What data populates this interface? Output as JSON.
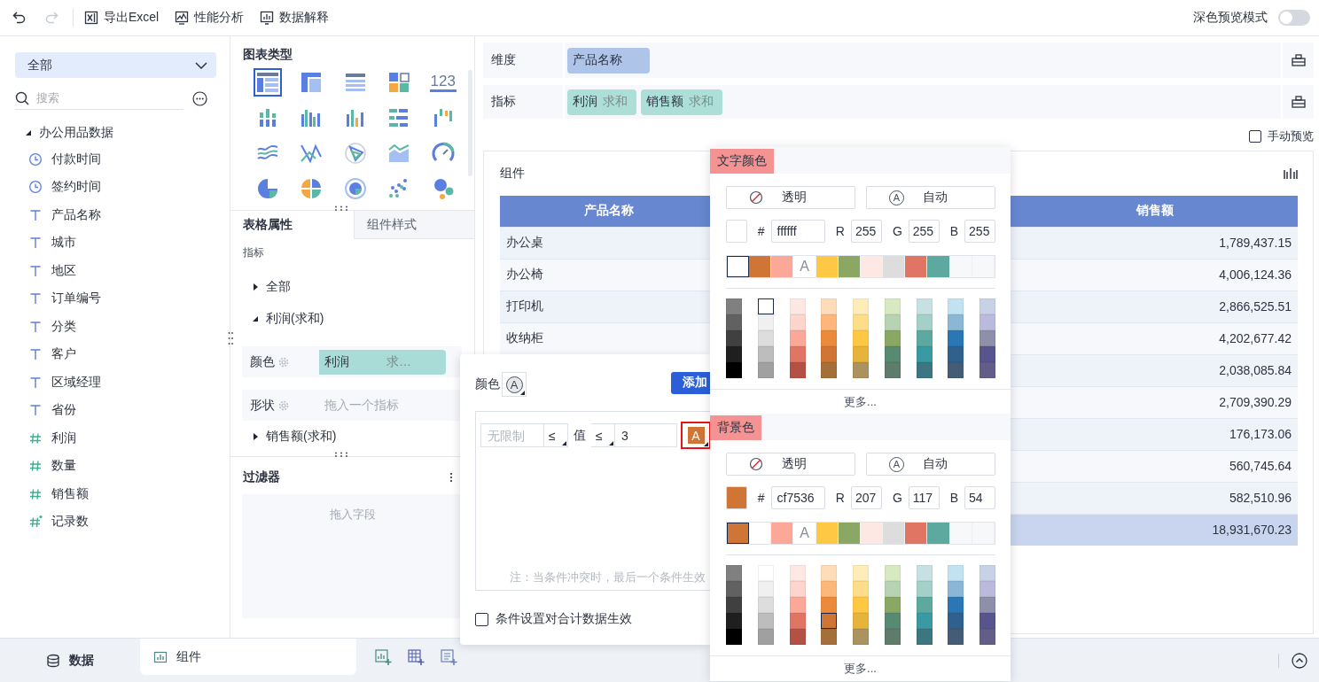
{
  "toolbar": {
    "undo_disabled": false,
    "redo_disabled": true,
    "actions": [
      {
        "kind": "excel",
        "label": "导出Excel"
      },
      {
        "kind": "performance",
        "label": "性能分析"
      },
      {
        "kind": "explain",
        "label": "数据解释"
      }
    ],
    "dark_preview": {
      "label": "深色预览模式",
      "on": false
    }
  },
  "fields_panel": {
    "dataset_select": "全部",
    "search": {
      "placeholder": "搜索"
    },
    "tree": [
      {
        "label": "办公用品数据",
        "expanded": true,
        "children": [
          {
            "kind": "time",
            "label": "付款时间"
          },
          {
            "kind": "time",
            "label": "签约时间"
          },
          {
            "kind": "text",
            "label": "产品名称"
          },
          {
            "kind": "text",
            "label": "城市"
          },
          {
            "kind": "text",
            "label": "地区"
          },
          {
            "kind": "text",
            "label": "订单编号"
          },
          {
            "kind": "text",
            "label": "分类"
          },
          {
            "kind": "text",
            "label": "客户"
          },
          {
            "kind": "text",
            "label": "区域经理"
          },
          {
            "kind": "text",
            "label": "省份"
          },
          {
            "kind": "number",
            "label": "利润"
          },
          {
            "kind": "number",
            "label": "数量"
          },
          {
            "kind": "number",
            "label": "销售额"
          },
          {
            "kind": "calc",
            "label": "记录数"
          }
        ]
      }
    ]
  },
  "config_panel": {
    "chart_type_title": "图表类型",
    "chart_types": [
      {
        "kind": "table",
        "selected": true
      },
      {
        "kind": "crosstab",
        "selected": false
      },
      {
        "kind": "detail",
        "selected": false
      },
      {
        "kind": "blocks",
        "selected": false
      },
      {
        "kind": "kpi",
        "label": "123",
        "selected": false
      },
      {
        "kind": "stacked",
        "selected": false
      },
      {
        "kind": "grouped",
        "selected": false
      },
      {
        "kind": "bar",
        "selected": false
      },
      {
        "kind": "hbar",
        "selected": false
      },
      {
        "kind": "waterfall",
        "selected": false
      },
      {
        "kind": "line",
        "selected": false
      },
      {
        "kind": "polyline",
        "selected": false
      },
      {
        "kind": "radar",
        "selected": false
      },
      {
        "kind": "area",
        "selected": false
      },
      {
        "kind": "gauge",
        "selected": false
      },
      {
        "kind": "pie",
        "selected": false
      },
      {
        "kind": "multipie",
        "selected": false
      },
      {
        "kind": "ring",
        "selected": false
      },
      {
        "kind": "scatter",
        "selected": false
      },
      {
        "kind": "bubble",
        "selected": false
      }
    ],
    "tabs": [
      {
        "label": "表格属性",
        "selected": true
      },
      {
        "label": "组件样式",
        "selected": false
      }
    ],
    "section_label": "指标",
    "measures": [
      {
        "label": "全部",
        "expanded": false
      },
      {
        "label": "利润(求和)",
        "expanded": true,
        "properties": [
          {
            "label": "颜色",
            "field": "利润",
            "aggregation": "求…"
          },
          {
            "label": "形状",
            "placeholder": "拖入一个指标"
          }
        ]
      },
      {
        "label": "销售额(求和)",
        "expanded": false
      }
    ],
    "filter": {
      "title": "过滤器",
      "placeholder": "拖入字段"
    }
  },
  "editor": {
    "dimension": {
      "label": "维度",
      "pills": [
        {
          "field": "产品名称"
        }
      ]
    },
    "measure": {
      "label": "指标",
      "pills": [
        {
          "field": "利润",
          "aggregation": "求和"
        },
        {
          "field": "销售额",
          "aggregation": "求和"
        }
      ]
    },
    "manual_preview": {
      "label": "手动预览",
      "checked": false
    },
    "component": {
      "title": "组件",
      "table": {
        "columns": [
          "产品名称",
          "销售额"
        ],
        "rows": [
          {
            "kind": "data",
            "product": "办公桌",
            "sales": "1,789,437.15"
          },
          {
            "kind": "data",
            "product": "办公椅",
            "sales": "4,006,124.36"
          },
          {
            "kind": "data",
            "product": "打印机",
            "sales": "2,866,525.51"
          },
          {
            "kind": "data",
            "product": "收纳柜",
            "sales": "4,202,677.42"
          },
          {
            "kind": "data",
            "sales": "2,038,085.84"
          },
          {
            "kind": "data",
            "sales": "2,709,390.29"
          },
          {
            "kind": "data",
            "sales": "176,173.06"
          },
          {
            "kind": "data",
            "sales": "560,745.64"
          },
          {
            "kind": "data",
            "sales": "582,510.96"
          },
          {
            "kind": "total",
            "sales": "18,931,670.23"
          }
        ]
      }
    }
  },
  "bottom_bar": {
    "tabs": [
      {
        "kind": "data",
        "label": "数据",
        "selected": false
      },
      {
        "kind": "component",
        "label": "组件",
        "selected": true
      }
    ]
  },
  "condition_popup": {
    "color_label": "颜色",
    "color_icon": "A",
    "add_button": "添加",
    "condition": {
      "range_placeholder": "无限制",
      "op1": "≤",
      "value_label": "值",
      "op2": "≤",
      "value": "3",
      "color_icon": "A",
      "color": "#cf7536",
      "highlighted": true
    },
    "note": "注：当条件冲突时，最后一个条件生效",
    "apply_to_total": {
      "label": "条件设置对合计数据生效",
      "checked": false
    }
  },
  "color_picker": {
    "sections": [
      {
        "title": "文字颜色",
        "transparent": "透明",
        "auto": "自动",
        "auto_icon": "A",
        "current_swatch": {
          "color": "#ffffff"
        },
        "hex_label": "#",
        "hex": "ffffff",
        "channels": [
          {
            "label": "R",
            "value": "255"
          },
          {
            "label": "G",
            "value": "255"
          },
          {
            "label": "B",
            "value": "255"
          }
        ],
        "recent": [
          {
            "kind": "swatch",
            "color": "#ffffff",
            "selected": true
          },
          {
            "kind": "swatch",
            "color": "#cf7536",
            "selected": false
          },
          {
            "kind": "swatch",
            "color": "#fba898",
            "selected": false
          },
          {
            "kind": "auto",
            "label": "A",
            "selected": false
          },
          {
            "kind": "swatch",
            "color": "#fec845",
            "selected": false
          },
          {
            "kind": "swatch",
            "color": "#8aa764",
            "selected": false
          },
          {
            "kind": "swatch",
            "color": "#fde8e4",
            "selected": false
          },
          {
            "kind": "swatch",
            "color": "#dddddd",
            "selected": false
          },
          {
            "kind": "swatch",
            "color": "#e07563",
            "selected": false
          },
          {
            "kind": "swatch",
            "color": "#5ea99f",
            "selected": false
          },
          {
            "kind": "swatch",
            "color": "#f7f8fa",
            "selected": false
          },
          {
            "kind": "swatch",
            "color": "#f7f8fa",
            "selected": false
          }
        ],
        "palette": [
          [
            {
              "color": "#808080",
              "selected": false
            },
            {
              "color": "#616161",
              "selected": false
            },
            {
              "color": "#404040",
              "selected": false
            },
            {
              "color": "#1f1f1f",
              "selected": false
            },
            {
              "color": "#000000",
              "selected": false
            }
          ],
          [
            {
              "color": "#ffffff",
              "selected": true
            },
            {
              "color": "#f0f0f0",
              "selected": false
            },
            {
              "color": "#dddddd",
              "selected": false
            },
            {
              "color": "#bdbdbd",
              "selected": false
            },
            {
              "color": "#a0a0a0",
              "selected": false
            }
          ],
          [
            {
              "color": "#fde8e4",
              "selected": false
            },
            {
              "color": "#fdd5cc",
              "selected": false
            },
            {
              "color": "#fba898",
              "selected": false
            },
            {
              "color": "#e07563",
              "selected": false
            },
            {
              "color": "#b35244",
              "selected": false
            }
          ],
          [
            {
              "color": "#fedcb9",
              "selected": false
            },
            {
              "color": "#fdb77a",
              "selected": false
            },
            {
              "color": "#eb8a3b",
              "selected": false
            },
            {
              "color": "#cf7536",
              "selected": false
            },
            {
              "color": "#a56f3a",
              "selected": false
            }
          ],
          [
            {
              "color": "#feedb9",
              "selected": false
            },
            {
              "color": "#fedd8a",
              "selected": false
            },
            {
              "color": "#fec845",
              "selected": false
            },
            {
              "color": "#e6b43c",
              "selected": false
            },
            {
              "color": "#aa935f",
              "selected": false
            }
          ],
          [
            {
              "color": "#d6e9c0",
              "selected": false
            },
            {
              "color": "#b8d3b4",
              "selected": false
            },
            {
              "color": "#8aa764",
              "selected": false
            },
            {
              "color": "#578a70",
              "selected": false
            },
            {
              "color": "#5e7b6c",
              "selected": false
            }
          ],
          [
            {
              "color": "#c7e1e2",
              "selected": false
            },
            {
              "color": "#a4d1c7",
              "selected": false
            },
            {
              "color": "#5ea99f",
              "selected": false
            },
            {
              "color": "#3a9aa3",
              "selected": false
            },
            {
              "color": "#3d7680",
              "selected": false
            }
          ],
          [
            {
              "color": "#c0e2f1",
              "selected": false
            },
            {
              "color": "#8ab7d5",
              "selected": false
            },
            {
              "color": "#2b77b5",
              "selected": false
            },
            {
              "color": "#30618e",
              "selected": false
            },
            {
              "color": "#445c75",
              "selected": false
            }
          ],
          [
            {
              "color": "#c8d2e6",
              "selected": false
            },
            {
              "color": "#bbbadd",
              "selected": false
            },
            {
              "color": "#8e8fa8",
              "selected": false
            },
            {
              "color": "#57548e",
              "selected": false
            },
            {
              "color": "#635e87",
              "selected": false
            }
          ]
        ],
        "more": "更多..."
      },
      {
        "title": "背景色",
        "transparent": "透明",
        "auto": "自动",
        "auto_icon": "A",
        "current_swatch": {
          "color": "#cf7536"
        },
        "hex_label": "#",
        "hex": "cf7536",
        "channels": [
          {
            "label": "R",
            "value": "207"
          },
          {
            "label": "G",
            "value": "117"
          },
          {
            "label": "B",
            "value": "54"
          }
        ],
        "recent": [
          {
            "kind": "swatch",
            "color": "#cf7536",
            "selected": true
          },
          {
            "kind": "swatch",
            "color": "#ffffff",
            "selected": false
          },
          {
            "kind": "swatch",
            "color": "#fba898",
            "selected": false
          },
          {
            "kind": "auto",
            "label": "A",
            "selected": false
          },
          {
            "kind": "swatch",
            "color": "#fec845",
            "selected": false
          },
          {
            "kind": "swatch",
            "color": "#8aa764",
            "selected": false
          },
          {
            "kind": "swatch",
            "color": "#fde8e4",
            "selected": false
          },
          {
            "kind": "swatch",
            "color": "#dddddd",
            "selected": false
          },
          {
            "kind": "swatch",
            "color": "#e07563",
            "selected": false
          },
          {
            "kind": "swatch",
            "color": "#5ea99f",
            "selected": false
          },
          {
            "kind": "swatch",
            "color": "#f7f8fa",
            "selected": false
          },
          {
            "kind": "swatch",
            "color": "#f7f8fa",
            "selected": false
          }
        ],
        "palette": [
          [
            {
              "color": "#808080",
              "selected": false
            },
            {
              "color": "#616161",
              "selected": false
            },
            {
              "color": "#404040",
              "selected": false
            },
            {
              "color": "#1f1f1f",
              "selected": false
            },
            {
              "color": "#000000",
              "selected": false
            }
          ],
          [
            {
              "color": "#ffffff",
              "selected": false
            },
            {
              "color": "#f0f0f0",
              "selected": false
            },
            {
              "color": "#dddddd",
              "selected": false
            },
            {
              "color": "#bdbdbd",
              "selected": false
            },
            {
              "color": "#a0a0a0",
              "selected": false
            }
          ],
          [
            {
              "color": "#fde8e4",
              "selected": false
            },
            {
              "color": "#fdd5cc",
              "selected": false
            },
            {
              "color": "#fba898",
              "selected": false
            },
            {
              "color": "#e07563",
              "selected": false
            },
            {
              "color": "#b35244",
              "selected": false
            }
          ],
          [
            {
              "color": "#fedcb9",
              "selected": false
            },
            {
              "color": "#fdb77a",
              "selected": false
            },
            {
              "color": "#eb8a3b",
              "selected": false
            },
            {
              "color": "#cf7536",
              "selected": true
            },
            {
              "color": "#a56f3a",
              "selected": false
            }
          ],
          [
            {
              "color": "#feedb9",
              "selected": false
            },
            {
              "color": "#fedd8a",
              "selected": false
            },
            {
              "color": "#fec845",
              "selected": false
            },
            {
              "color": "#e6b43c",
              "selected": false
            },
            {
              "color": "#aa935f",
              "selected": false
            }
          ],
          [
            {
              "color": "#d6e9c0",
              "selected": false
            },
            {
              "color": "#b8d3b4",
              "selected": false
            },
            {
              "color": "#8aa764",
              "selected": false
            },
            {
              "color": "#578a70",
              "selected": false
            },
            {
              "color": "#5e7b6c",
              "selected": false
            }
          ],
          [
            {
              "color": "#c7e1e2",
              "selected": false
            },
            {
              "color": "#a4d1c7",
              "selected": false
            },
            {
              "color": "#5ea99f",
              "selected": false
            },
            {
              "color": "#3a9aa3",
              "selected": false
            },
            {
              "color": "#3d7680",
              "selected": false
            }
          ],
          [
            {
              "color": "#c0e2f1",
              "selected": false
            },
            {
              "color": "#8ab7d5",
              "selected": false
            },
            {
              "color": "#2b77b5",
              "selected": false
            },
            {
              "color": "#30618e",
              "selected": false
            },
            {
              "color": "#445c75",
              "selected": false
            }
          ],
          [
            {
              "color": "#c8d2e6",
              "selected": false
            },
            {
              "color": "#bbbadd",
              "selected": false
            },
            {
              "color": "#8e8fa8",
              "selected": false
            },
            {
              "color": "#57548e",
              "selected": false
            },
            {
              "color": "#635e87",
              "selected": false
            }
          ]
        ],
        "more": "更多..."
      }
    ]
  }
}
